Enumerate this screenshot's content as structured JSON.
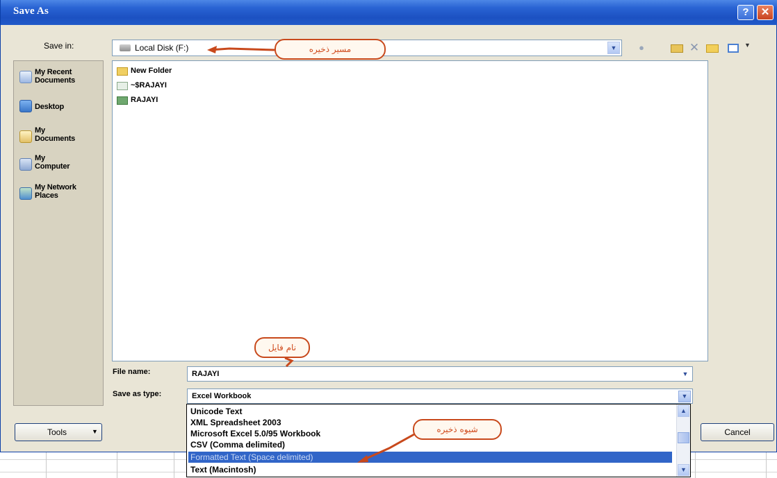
{
  "window": {
    "title": "Save As",
    "help_label": "?",
    "close_label": "✕"
  },
  "save_in": {
    "label": "Save in:",
    "value": "Local Disk (F:)"
  },
  "toolbar": {
    "icons": [
      "back-icon",
      "up-folder-icon",
      "delete-icon",
      "new-folder-icon",
      "views-icon"
    ]
  },
  "places": [
    {
      "label": "My Recent\nDocuments",
      "icon": "recent-documents-icon"
    },
    {
      "label": "Desktop",
      "icon": "desktop-icon"
    },
    {
      "label": "My\nDocuments",
      "icon": "my-documents-icon"
    },
    {
      "label": "My\nComputer",
      "icon": "my-computer-icon"
    },
    {
      "label": "My Network\nPlaces",
      "icon": "network-places-icon"
    }
  ],
  "files": [
    {
      "name": "New Folder",
      "icon": "folder-icon"
    },
    {
      "name": "~$RAJAYI",
      "icon": "excel-temp-icon"
    },
    {
      "name": "RAJAYI",
      "icon": "excel-file-icon"
    }
  ],
  "file_name": {
    "label": "File name:",
    "value": "RAJAYI"
  },
  "save_type": {
    "label": "Save as type:",
    "value": "Excel Workbook",
    "options": [
      "Unicode Text",
      "XML Spreadsheet 2003",
      "Microsoft Excel 5.0/95 Workbook",
      "CSV (Comma delimited)",
      "Formatted Text (Space delimited)",
      "Text (Macintosh)"
    ],
    "selected_index": 4
  },
  "buttons": {
    "tools": "Tools",
    "cancel": "Cancel"
  },
  "annotations": {
    "path": "مسیر ذخیره",
    "filename": "نام فایل",
    "type": "شیوه ذخیره"
  },
  "colors": {
    "titlebar": "#2a64d4",
    "selection": "#3165c8",
    "annotation": "#c8491c"
  }
}
